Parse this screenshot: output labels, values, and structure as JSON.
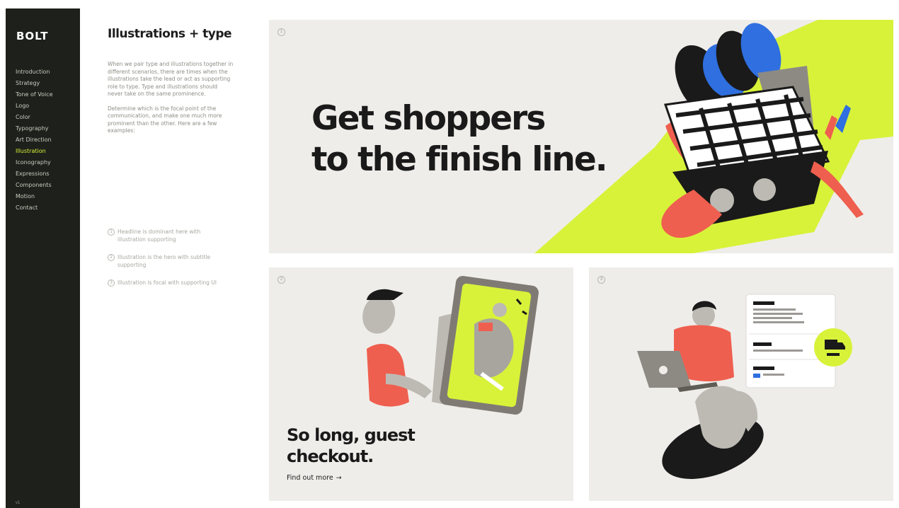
{
  "brand": {
    "logo": "BOLT"
  },
  "sidebar": {
    "items": [
      {
        "label": "Introduction"
      },
      {
        "label": "Strategy"
      },
      {
        "label": "Tone of Voice"
      },
      {
        "label": "Logo"
      },
      {
        "label": "Color"
      },
      {
        "label": "Typography"
      },
      {
        "label": "Art Direction"
      },
      {
        "label": "Illustration",
        "active": true
      },
      {
        "label": "Iconography"
      },
      {
        "label": "Expressions"
      },
      {
        "label": "Components"
      },
      {
        "label": "Motion"
      },
      {
        "label": "Contact"
      }
    ],
    "footer": "v1"
  },
  "section": {
    "title": "Illustrations + type",
    "paragraphs": [
      "When we pair type and illustrations together in different scenarios, there are times when the illustrations take the lead or act as supporting role to type. Type and illustrations should never take on the same prominence.",
      "Determine which is the focal point of the communication, and make one much more prominent than the other. Here are a few examples:"
    ],
    "examples": [
      {
        "num": "1",
        "text": "Headline is dominant here with illustration supporting"
      },
      {
        "num": "2",
        "text": "Illustration is the hero with subtitle supporting"
      },
      {
        "num": "3",
        "text": "Illustration is focal with supporting UI"
      }
    ]
  },
  "hero": {
    "badge": "1",
    "headline_line1": "Get shoppers",
    "headline_line2": "to the finish line."
  },
  "card_a": {
    "badge": "2",
    "headline_line1": "So long, guest",
    "headline_line2": "checkout.",
    "link_label": "Find out more",
    "link_arrow": "→"
  },
  "card_b": {
    "badge": "3"
  },
  "colors": {
    "sidebar_bg": "#1e211b",
    "accent_lime": "#d8f23a",
    "coral": "#ef5f4f",
    "blue": "#2f6fe0",
    "card_bg": "#efedea",
    "ink": "#1a1a1a"
  }
}
